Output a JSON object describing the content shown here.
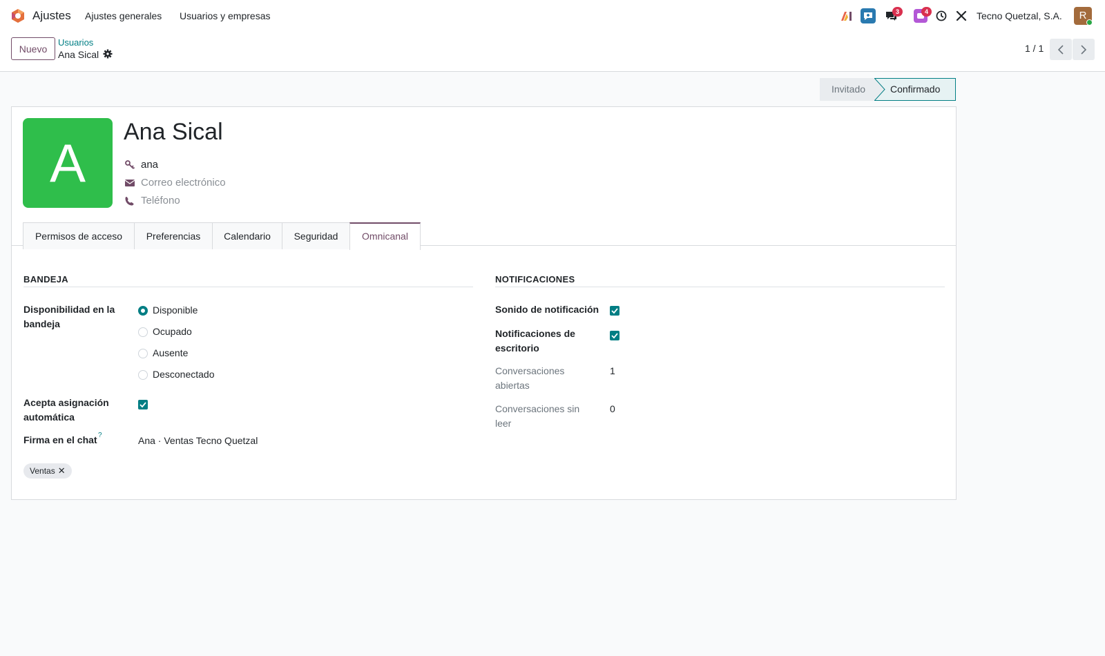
{
  "navbar": {
    "app_name": "Ajustes",
    "menu": [
      "Ajustes generales",
      "Usuarios y empresas"
    ],
    "badges": {
      "chat": "3",
      "activity": "4"
    },
    "company": "Tecno Quetzal, S.A.",
    "user_initial": "R"
  },
  "control_panel": {
    "new_button": "Nuevo",
    "breadcrumb_parent": "Usuarios",
    "breadcrumb_current": "Ana Sical",
    "pager": "1 / 1"
  },
  "status": {
    "steps": [
      "Invitado",
      "Confirmado"
    ],
    "current": "Confirmado"
  },
  "user": {
    "initial": "A",
    "name": "Ana Sical",
    "login": "ana",
    "email_placeholder": "Correo electrónico",
    "phone_placeholder": "Teléfono"
  },
  "tabs": [
    "Permisos de acceso",
    "Preferencias",
    "Calendario",
    "Seguridad",
    "Omnicanal"
  ],
  "active_tab": "Omnicanal",
  "bandeja": {
    "title": "BANDEJA",
    "availability_label_1": "Disponibilidad en la",
    "availability_label_2": "bandeja",
    "options": [
      "Disponible",
      "Ocupado",
      "Ausente",
      "Desconectado"
    ],
    "selected": "Disponible",
    "auto_assign_label_1": "Acepta asignación",
    "auto_assign_label_2": "automática",
    "auto_assign": true,
    "signature_label": "Firma en el chat",
    "signature_help": "?",
    "signature_value": "Ana · Ventas Tecno Quetzal",
    "tag": "Ventas"
  },
  "notificaciones": {
    "title": "NOTIFICACIONES",
    "sound_label": "Sonido de notificación",
    "sound": true,
    "desktop_label_1": "Notificaciones de",
    "desktop_label_2": "escritorio",
    "desktop": true,
    "open_label_1": "Conversaciones",
    "open_label_2": "abiertas",
    "open_value": "1",
    "unread_label_1": "Conversaciones sin",
    "unread_label_2": "leer",
    "unread_value": "0"
  },
  "colors": {
    "primary": "#714b67",
    "accent": "#017e84",
    "avatar": "#2fbe4b"
  }
}
